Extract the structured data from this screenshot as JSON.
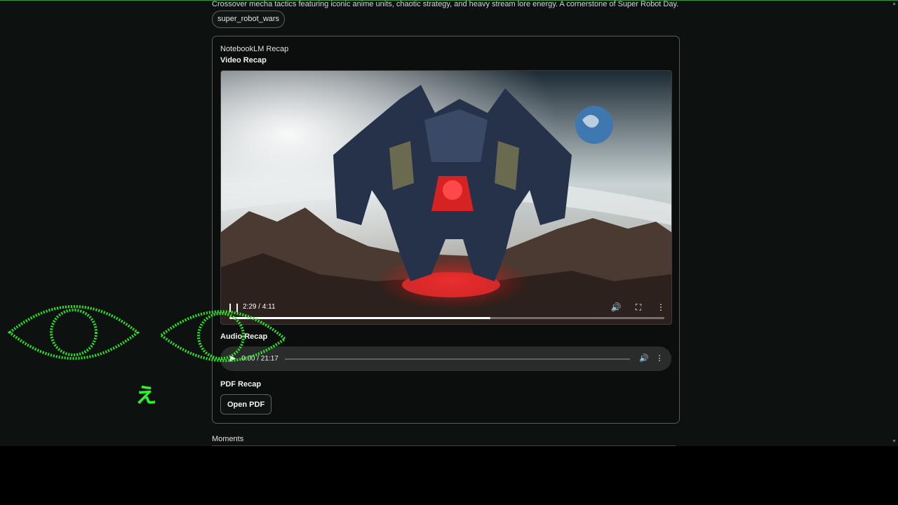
{
  "description": "Crossover mecha tactics featuring iconic anime units, chaotic strategy, and heavy stream lore energy. A cornerstone of Super Robot Day.",
  "tag": "super_robot_wars",
  "card": {
    "title": "NotebookLM Recap",
    "video_section": "Video Recap",
    "video": {
      "time": "2:29 / 4:11",
      "progress": 0.6
    },
    "audio_section": "Audio Recap",
    "audio": {
      "time": "0:00 / 21:17",
      "progress": 0.0
    },
    "pdf_section": "PDF Recap",
    "open_pdf_label": "Open PDF"
  },
  "moments_heading": "Moments",
  "overlay": {
    "glyph": "ぇ",
    "color": "#2cf22a"
  },
  "icons": [
    "pause-icon",
    "volume-icon",
    "fullscreen-icon",
    "more-icon",
    "play-icon"
  ]
}
